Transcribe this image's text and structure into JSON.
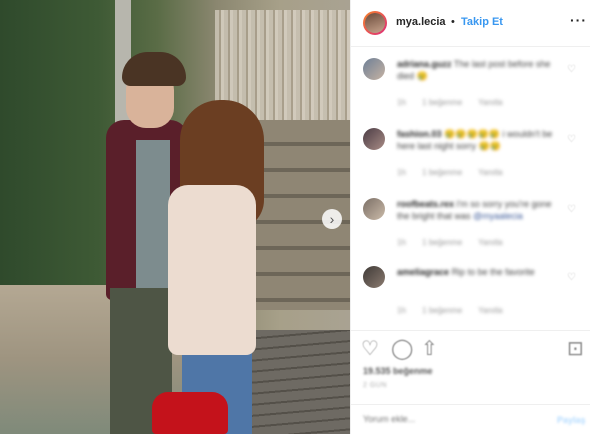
{
  "header": {
    "username": "mya.lecia",
    "separator": "•",
    "follow_label": "Takip Et",
    "more_icon": "···"
  },
  "photo": {
    "next_icon": "›"
  },
  "comments": [
    {
      "username": "adriana.guzz",
      "text": "The last post before she died 😢",
      "time": "1h",
      "likes": "1 beğenme",
      "reply": "Yanıtla"
    },
    {
      "username": "fashion.03",
      "text": "😢😢😢😢😢 i wouldn't be here last night sorry 😢😢",
      "time": "1h",
      "likes": "1 beğenme",
      "reply": "Yanıtla"
    },
    {
      "username": "roofbeats.rex",
      "text": "i'm so sorry you're gone the bright that was",
      "mention": "@myaalecia",
      "time": "1h",
      "likes": "1 beğenme",
      "reply": "Yanıtla"
    },
    {
      "username": "ameliagrace",
      "text": "Rip to be the favorite",
      "time": "1h",
      "likes": "1 beğenme",
      "reply": "Yanıtla"
    }
  ],
  "actions": {
    "like_icon": "♡",
    "comment_icon": "◯",
    "share_icon": "⇧",
    "save_icon": "⊡"
  },
  "likes_text": "19.535 beğenme",
  "date_text": "2 GÜN",
  "add_comment": {
    "placeholder": "Yorum ekle...",
    "post_label": "Paylaş"
  }
}
